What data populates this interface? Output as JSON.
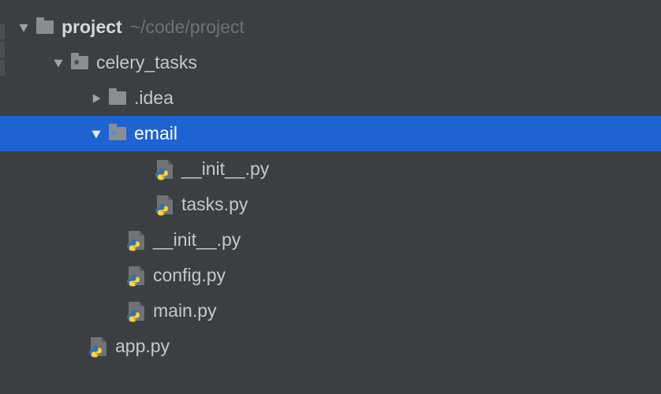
{
  "root": {
    "name": "project",
    "path": "~/code/project"
  },
  "celery": "celery_tasks",
  "idea": ".idea",
  "email": "email",
  "email_init": "__init__.py",
  "email_tasks": "tasks.py",
  "celery_init": "__init__.py",
  "config": "config.py",
  "main": "main.py",
  "app": "app.py",
  "colors": {
    "selection": "#1d63d1",
    "bg": "#3c3f41"
  }
}
